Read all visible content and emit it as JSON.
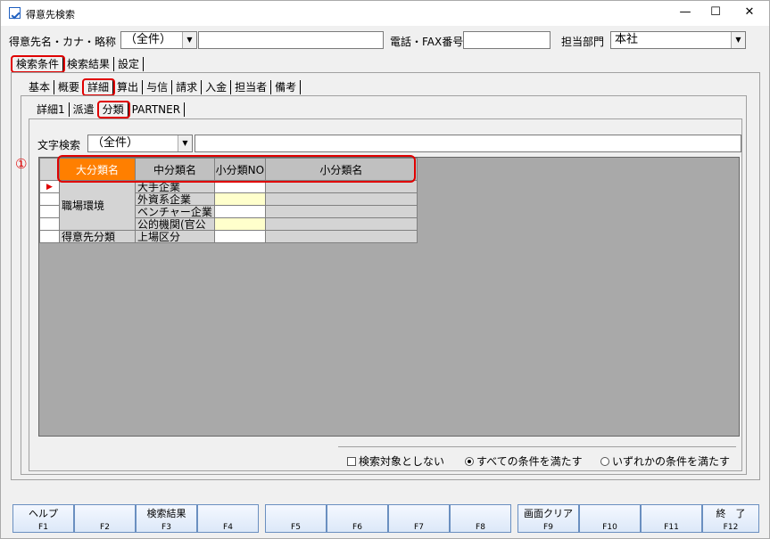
{
  "window": {
    "title": "得意先検索",
    "min": "—",
    "max": "☐",
    "close": "✕"
  },
  "search": {
    "name_label": "得意先名・カナ・略称",
    "name_filter": "（全件）",
    "name_value": "",
    "phone_label": "電話・FAX番号",
    "phone_value": "",
    "dept_label": "担当部門",
    "dept_value": "本社"
  },
  "main_tabs": [
    "検索条件",
    "検索結果",
    "設定"
  ],
  "sub_tabs": [
    "基本",
    "概要",
    "詳細",
    "算出",
    "与信",
    "請求",
    "入金",
    "担当者",
    "備考"
  ],
  "detail_tabs": [
    "詳細1",
    "派遣",
    "分類",
    "PARTNER"
  ],
  "text_search": {
    "label": "文字検索",
    "filter": "（全件）",
    "value": ""
  },
  "annotation": "①",
  "grid": {
    "headers": [
      "大分類名",
      "中分類名",
      "小分類NO",
      "小分類名"
    ],
    "group1": "職場環境",
    "group2": "得意先分類",
    "rows": [
      "大手企業",
      "外資系企業",
      "ベンチャー企業",
      "公的機関(官公",
      "上場区分"
    ],
    "row_marker": "▶"
  },
  "options": {
    "exclude": "検索対象としない",
    "all": "すべての条件を満たす",
    "any": "いずれかの条件を満たす"
  },
  "fkeys": [
    {
      "label": "ヘルプ",
      "key": "F1"
    },
    {
      "label": "",
      "key": "F2"
    },
    {
      "label": "検索結果",
      "key": "F3"
    },
    {
      "label": "",
      "key": "F4"
    },
    {
      "label": "",
      "key": "F5"
    },
    {
      "label": "",
      "key": "F6"
    },
    {
      "label": "",
      "key": "F7"
    },
    {
      "label": "",
      "key": "F8"
    },
    {
      "label": "画面クリア",
      "key": "F9"
    },
    {
      "label": "",
      "key": "F10"
    },
    {
      "label": "",
      "key": "F11"
    },
    {
      "label": "終　了",
      "key": "F12"
    }
  ],
  "colors": {
    "accent": "#ff7f00",
    "highlight": "#e00000",
    "yellow": "#ffffcc"
  }
}
